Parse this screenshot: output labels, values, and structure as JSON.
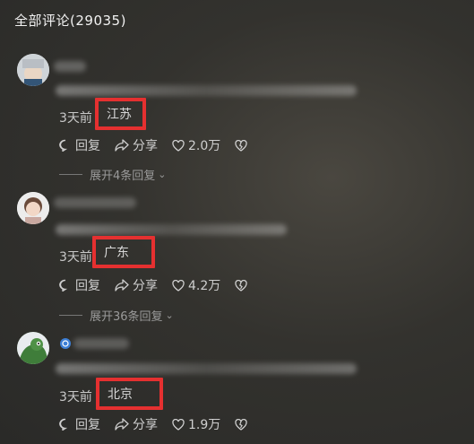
{
  "header": {
    "title": "全部评论(29035)"
  },
  "comments": [
    {
      "time": "3天前",
      "location": "江苏",
      "reply_label": "回复",
      "share_label": "分享",
      "likes": "2.0万",
      "expand_label": "展开4条回复"
    },
    {
      "time": "3天前",
      "location": "广东",
      "reply_label": "回复",
      "share_label": "分享",
      "likes": "4.2万",
      "expand_label": "展开36条回复"
    },
    {
      "time": "3天前",
      "location": "北京",
      "reply_label": "回复",
      "share_label": "分享",
      "likes": "1.9万"
    }
  ],
  "colors": {
    "highlight_box": "#e53030",
    "background": "#33322e"
  },
  "icons": [
    "comment-icon",
    "share-icon",
    "heart-icon",
    "broken-heart-icon",
    "chevron-down-icon"
  ]
}
